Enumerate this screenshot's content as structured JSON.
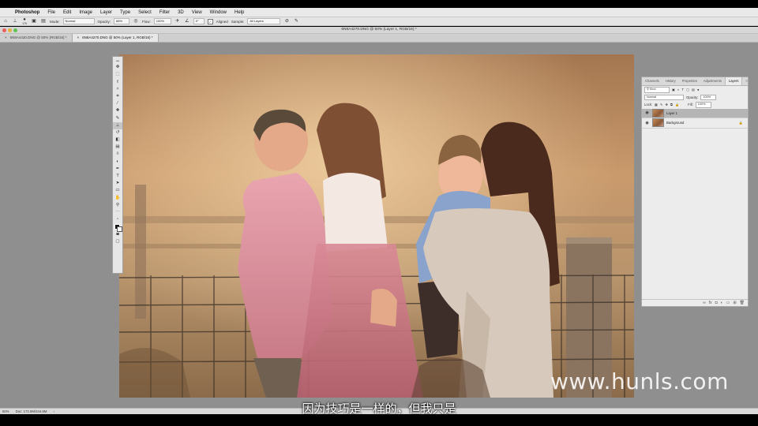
{
  "menubar": {
    "app": "Photoshop",
    "items": [
      "File",
      "Edit",
      "Image",
      "Layer",
      "Type",
      "Select",
      "Filter",
      "3D",
      "View",
      "Window",
      "Help"
    ]
  },
  "options": {
    "brush_size": "175",
    "mode_label": "Mode:",
    "mode_value": "Normal",
    "opacity_label": "Opacity:",
    "opacity_value": "68%",
    "flow_label": "Flow:",
    "flow_value": "100%",
    "angle_value": "0°",
    "aligned_label": "Aligned",
    "sample_label": "Sample:",
    "sample_value": "All Layers"
  },
  "window": {
    "title": "6N8A4270.DNG @ 50% (Layer 1, RGB/16) *"
  },
  "tabs": [
    {
      "label": "6N8A4430.DNG @ 50% (RGB/16) *"
    },
    {
      "label": "6N8A4270.DNG @ 50% (Layer 1, RGB/16) *"
    }
  ],
  "panel": {
    "tabs": [
      "Channels",
      "History",
      "Properties",
      "Adjustments",
      "Layers"
    ],
    "filter_value": "Kind",
    "blend_value": "Normal",
    "opacity_label": "Opacity:",
    "opacity_value": "100%",
    "lock_label": "Lock:",
    "fill_label": "Fill:",
    "fill_value": "100%",
    "layers": [
      {
        "name": "Layer 1",
        "selected": true
      },
      {
        "name": "Background",
        "selected": false
      }
    ]
  },
  "status": {
    "zoom": "50%",
    "doc": "Doc: 172.9M/344.6M"
  },
  "subtitle": "因为技巧是一样的，但我只是",
  "watermark": "www.hunls.com",
  "toolbar": {
    "tools": [
      "move-tool",
      "marquee-tool",
      "lasso-tool",
      "quick-select-tool",
      "crop-tool",
      "eyedropper-tool",
      "healing-tool",
      "brush-tool",
      "clone-stamp-tool",
      "history-brush-tool",
      "eraser-tool",
      "gradient-tool",
      "blur-tool",
      "dodge-tool",
      "pen-tool",
      "type-tool",
      "path-select-tool",
      "shape-tool",
      "hand-tool",
      "zoom-tool",
      "edit-toolbar",
      "more-tools",
      "color-swatches",
      "quick-mask",
      "screen-mode"
    ]
  }
}
